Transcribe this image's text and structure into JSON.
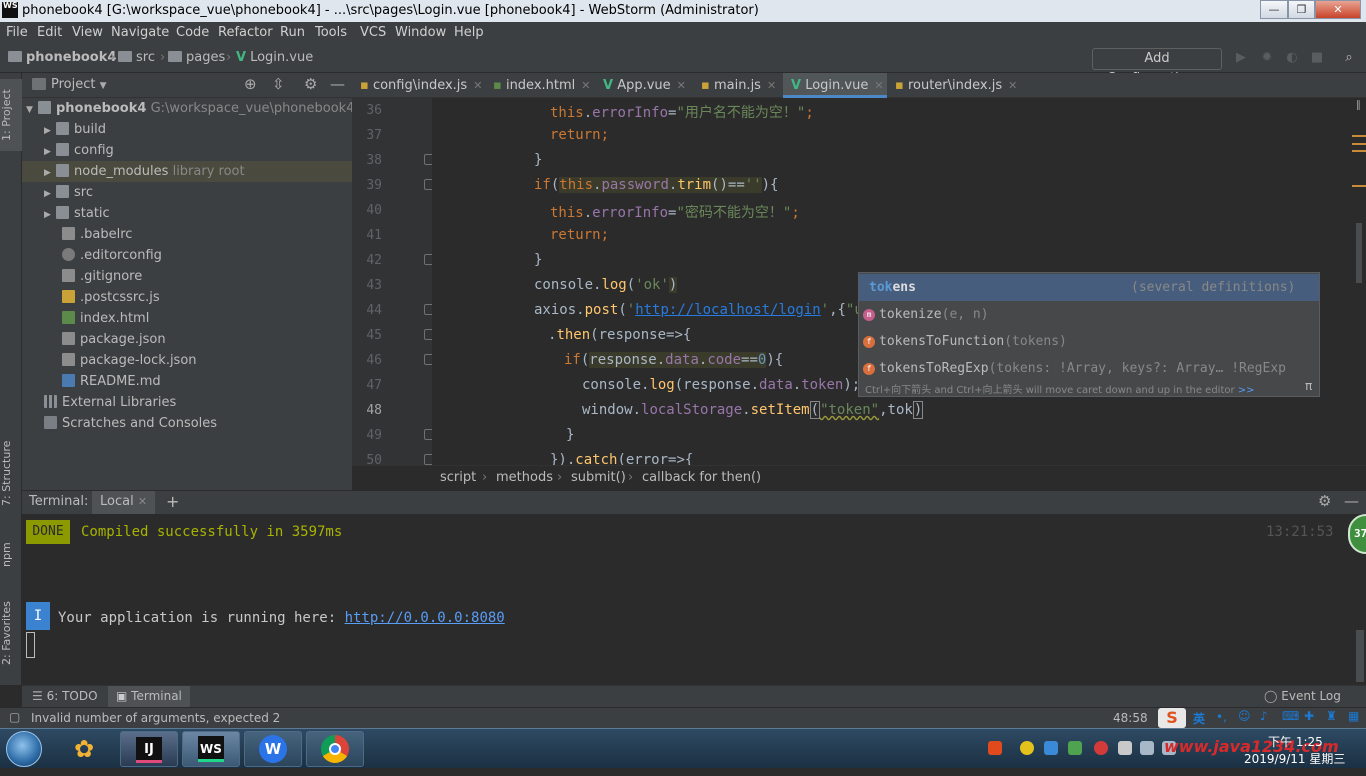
{
  "window": {
    "title": "phonebook4 [G:\\workspace_vue\\phonebook4] - ...\\src\\pages\\Login.vue [phonebook4] - WebStorm (Administrator)",
    "controls": {
      "minimize": "—",
      "maximize": "❐",
      "close": "✕"
    }
  },
  "menu": [
    "File",
    "Edit",
    "View",
    "Navigate",
    "Code",
    "Refactor",
    "Run",
    "Tools",
    "VCS",
    "Window",
    "Help"
  ],
  "navbar": {
    "crumbs": [
      "phonebook4",
      "src",
      "pages",
      "Login.vue"
    ],
    "add_config": "Add Configuration..."
  },
  "left_strip": {
    "project": "1: Project",
    "structure": "7: Structure",
    "npm": "npm",
    "favorites": "2: Favorites"
  },
  "project_panel": {
    "title": "Project",
    "tree": [
      {
        "name": "phonebook4",
        "extra": "G:\\workspace_vue\\phonebook4",
        "kind": "root"
      },
      {
        "name": "build",
        "extra": "",
        "kind": "folder"
      },
      {
        "name": "config",
        "extra": "",
        "kind": "folder"
      },
      {
        "name": "node_modules",
        "extra": "library root",
        "kind": "folder"
      },
      {
        "name": "src",
        "extra": "",
        "kind": "folder"
      },
      {
        "name": "static",
        "extra": "",
        "kind": "folder"
      },
      {
        "name": ".babelrc",
        "extra": "",
        "kind": "file"
      },
      {
        "name": ".editorconfig",
        "extra": "",
        "kind": "gear"
      },
      {
        "name": ".gitignore",
        "extra": "",
        "kind": "file"
      },
      {
        "name": ".postcssrc.js",
        "extra": "",
        "kind": "js"
      },
      {
        "name": "index.html",
        "extra": "",
        "kind": "html"
      },
      {
        "name": "package.json",
        "extra": "",
        "kind": "file"
      },
      {
        "name": "package-lock.json",
        "extra": "",
        "kind": "file"
      },
      {
        "name": "README.md",
        "extra": "",
        "kind": "md"
      },
      {
        "name": "External Libraries",
        "extra": "",
        "kind": "lib"
      },
      {
        "name": "Scratches and Consoles",
        "extra": "",
        "kind": "scratch"
      }
    ]
  },
  "editor_tabs": [
    "config\\index.js",
    "index.html",
    "App.vue",
    "main.js",
    "Login.vue",
    "router\\index.js"
  ],
  "line_numbers": [
    "36",
    "37",
    "38",
    "39",
    "40",
    "41",
    "42",
    "43",
    "44",
    "45",
    "46",
    "47",
    "48",
    "49",
    "50"
  ],
  "code": {
    "l36": [
      "this",
      ".",
      "errorInfo",
      "=",
      "\"用户名不能为空！\"",
      ";"
    ],
    "l37": [
      "return",
      ";"
    ],
    "l38": [
      "}"
    ],
    "l39": [
      "if",
      "(",
      "this",
      ".",
      "password",
      ".",
      "trim",
      "()==",
      "''",
      "){"
    ],
    "l40": [
      "this",
      ".",
      "errorInfo",
      "=",
      "\"密码不能为空！\"",
      ";"
    ],
    "l41": [
      "return",
      ";"
    ],
    "l42": [
      "}"
    ],
    "l43": [
      "console",
      ".",
      "log",
      "(",
      "'ok'",
      ")"
    ],
    "l44": [
      "axios",
      ".",
      "post",
      "(",
      "'",
      "http://localhost/login",
      "'",
      ",{",
      "\"use"
    ],
    "l45": [
      ".",
      "then",
      "(response=>{"
    ],
    "l46": [
      "if",
      "(",
      "response",
      ".",
      "data",
      ".",
      "code",
      "==",
      "0",
      "){"
    ],
    "l47": [
      "console",
      ".",
      "log",
      "(response.",
      "data",
      ".",
      "token",
      ");"
    ],
    "l48": [
      "window",
      ".",
      "localStorage",
      ".",
      "setItem",
      "(",
      "\"token\"",
      ",",
      "tok",
      ")"
    ],
    "l49": [
      "}"
    ],
    "l50": [
      "})",
      ".",
      "catch",
      "(error=>{"
    ]
  },
  "completion": {
    "items": [
      {
        "match": "tok",
        "rest": "ens",
        "sig": "(several definitions)"
      },
      {
        "match": "tok",
        "rest": "enize",
        "sig": "(e, n)"
      },
      {
        "match": "tok",
        "rest": "ensToFunction",
        "sig": "(tokens)"
      },
      {
        "match": "tok",
        "rest": "ensToRegExp",
        "sig": "(tokens: !Array, keys?: Array… !RegExp"
      }
    ],
    "hint": "Ctrl+向下箭头 and Ctrl+向上箭头 will move caret down and up in the editor",
    "hint_link": ">>",
    "pi": "π"
  },
  "editor_breadcrumb": [
    "script",
    "methods",
    "submit()",
    "callback for then()"
  ],
  "terminal": {
    "label": "Terminal:",
    "tab": "Local",
    "plus": "+",
    "done": "DONE",
    "compiled": "Compiled successfully in 3597ms",
    "time": "13:21:53",
    "info_badge": "I",
    "running_prefix": "Your application is running here: ",
    "running_url": "http://0.0.0.0:8080",
    "bubble": "37"
  },
  "bottom_tools": {
    "todo": "6: TODO",
    "terminal": "Terminal",
    "event_log": "Event Log"
  },
  "status": {
    "message": "Invalid number of arguments, expected 2",
    "position": "48:58",
    "lang": "英"
  },
  "taskbar": {
    "apps": [
      "IJ",
      "WS",
      "W"
    ],
    "time": "下午 1:25",
    "date": "2019/9/11 星期三",
    "watermark": "www.java1234.com"
  }
}
